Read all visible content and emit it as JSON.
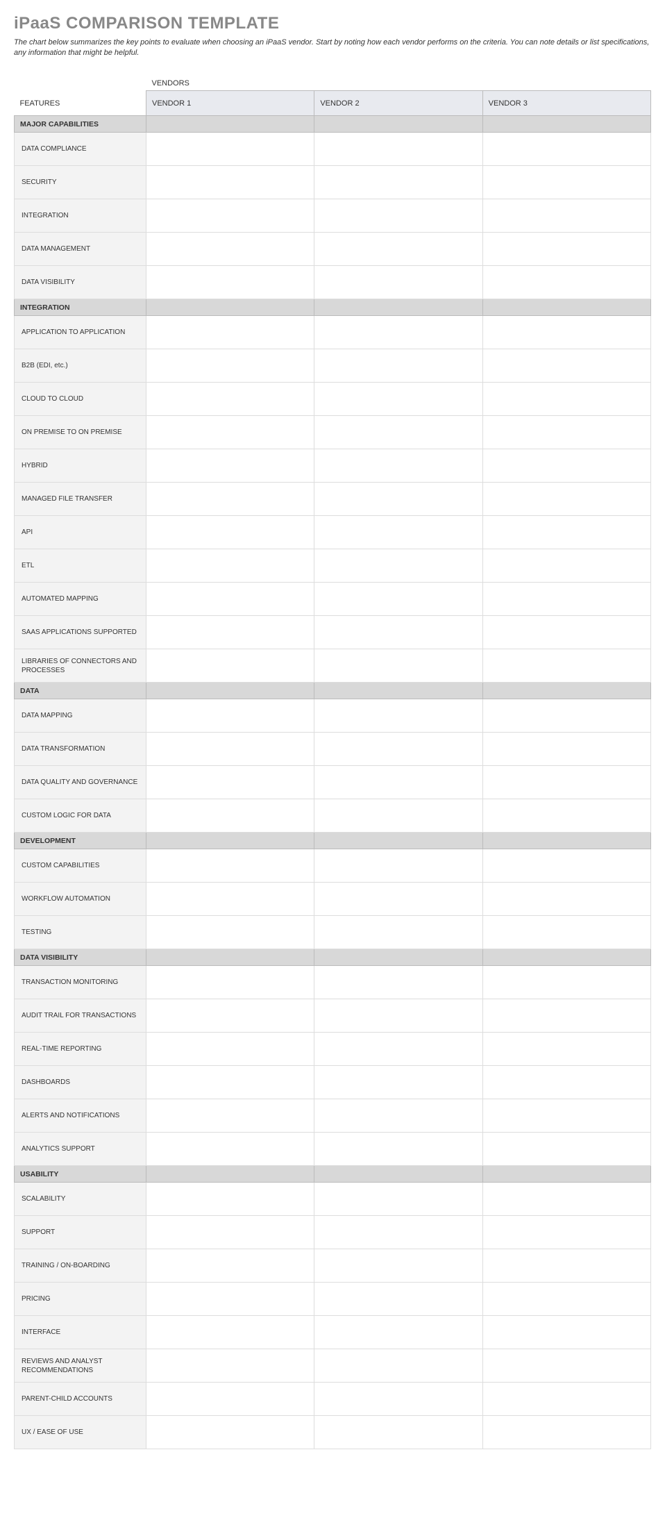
{
  "title": "iPaaS COMPARISON TEMPLATE",
  "description": "The chart below summarizes the key points to evaluate when choosing an iPaaS vendor. Start by noting how each vendor performs on the criteria. You can note details or list specifications, any information that might be helpful.",
  "vendors_label": "VENDORS",
  "features_label": "FEATURES",
  "vendor_headers": [
    "VENDOR 1",
    "VENDOR 2",
    "VENDOR 3"
  ],
  "sections": [
    {
      "title": "MAJOR CAPABILITIES",
      "rows": [
        {
          "label": "DATA COMPLIANCE",
          "v": [
            "",
            "",
            ""
          ]
        },
        {
          "label": "SECURITY",
          "v": [
            "",
            "",
            ""
          ]
        },
        {
          "label": "INTEGRATION",
          "v": [
            "",
            "",
            ""
          ]
        },
        {
          "label": "DATA MANAGEMENT",
          "v": [
            "",
            "",
            ""
          ]
        },
        {
          "label": "DATA VISIBILITY",
          "v": [
            "",
            "",
            ""
          ]
        }
      ]
    },
    {
      "title": "INTEGRATION",
      "rows": [
        {
          "label": "APPLICATION TO APPLICATION",
          "v": [
            "",
            "",
            ""
          ]
        },
        {
          "label": "B2B (EDI, etc.)",
          "v": [
            "",
            "",
            ""
          ]
        },
        {
          "label": "CLOUD TO CLOUD",
          "v": [
            "",
            "",
            ""
          ]
        },
        {
          "label": "ON PREMISE TO ON PREMISE",
          "v": [
            "",
            "",
            ""
          ]
        },
        {
          "label": "HYBRID",
          "v": [
            "",
            "",
            ""
          ]
        },
        {
          "label": "MANAGED FILE TRANSFER",
          "v": [
            "",
            "",
            ""
          ]
        },
        {
          "label": "API",
          "v": [
            "",
            "",
            ""
          ]
        },
        {
          "label": "ETL",
          "v": [
            "",
            "",
            ""
          ]
        },
        {
          "label": "AUTOMATED MAPPING",
          "v": [
            "",
            "",
            ""
          ]
        },
        {
          "label": "SAAS APPLICATIONS SUPPORTED",
          "v": [
            "",
            "",
            ""
          ]
        },
        {
          "label": "LIBRARIES OF CONNECTORS AND PROCESSES",
          "v": [
            "",
            "",
            ""
          ]
        }
      ]
    },
    {
      "title": "DATA",
      "rows": [
        {
          "label": "DATA MAPPING",
          "v": [
            "",
            "",
            ""
          ]
        },
        {
          "label": "DATA TRANSFORMATION",
          "v": [
            "",
            "",
            ""
          ]
        },
        {
          "label": "DATA QUALITY AND GOVERNANCE",
          "v": [
            "",
            "",
            ""
          ]
        },
        {
          "label": "CUSTOM LOGIC FOR DATA",
          "v": [
            "",
            "",
            ""
          ]
        }
      ]
    },
    {
      "title": "DEVELOPMENT",
      "rows": [
        {
          "label": "CUSTOM CAPABILITIES",
          "v": [
            "",
            "",
            ""
          ]
        },
        {
          "label": "WORKFLOW AUTOMATION",
          "v": [
            "",
            "",
            ""
          ]
        },
        {
          "label": "TESTING",
          "v": [
            "",
            "",
            ""
          ]
        }
      ]
    },
    {
      "title": "DATA VISIBILITY",
      "rows": [
        {
          "label": "TRANSACTION MONITORING",
          "v": [
            "",
            "",
            ""
          ]
        },
        {
          "label": "AUDIT TRAIL FOR TRANSACTIONS",
          "v": [
            "",
            "",
            ""
          ]
        },
        {
          "label": "REAL-TIME REPORTING",
          "v": [
            "",
            "",
            ""
          ]
        },
        {
          "label": "DASHBOARDS",
          "v": [
            "",
            "",
            ""
          ]
        },
        {
          "label": "ALERTS AND NOTIFICATIONS",
          "v": [
            "",
            "",
            ""
          ]
        },
        {
          "label": "ANALYTICS SUPPORT",
          "v": [
            "",
            "",
            ""
          ]
        }
      ]
    },
    {
      "title": "USABILITY",
      "rows": [
        {
          "label": "SCALABILITY",
          "v": [
            "",
            "",
            ""
          ]
        },
        {
          "label": "SUPPORT",
          "v": [
            "",
            "",
            ""
          ]
        },
        {
          "label": "TRAINING / ON-BOARDING",
          "v": [
            "",
            "",
            ""
          ]
        },
        {
          "label": "PRICING",
          "v": [
            "",
            "",
            ""
          ]
        },
        {
          "label": "INTERFACE",
          "v": [
            "",
            "",
            ""
          ]
        },
        {
          "label": "REVIEWS AND ANALYST RECOMMENDATIONS",
          "v": [
            "",
            "",
            ""
          ]
        },
        {
          "label": "PARENT-CHILD ACCOUNTS",
          "v": [
            "",
            "",
            ""
          ]
        },
        {
          "label": "UX / EASE OF USE",
          "v": [
            "",
            "",
            ""
          ]
        }
      ]
    }
  ]
}
